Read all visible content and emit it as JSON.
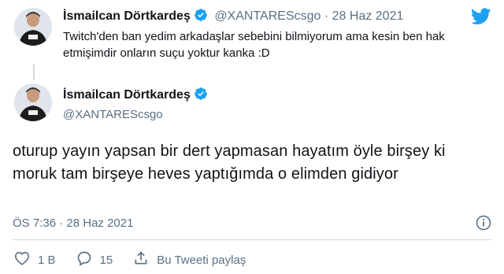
{
  "reply": {
    "author_name": "İsmailcan Dörtkardeş",
    "handle": "@XANTAREScsgo",
    "separator": "·",
    "date": "28 Haz 2021",
    "text": "Twitch'den ban yedim arkadaşlar sebebini bilmiyorum ama kesin ben hak etmişimdir onların suçu yoktur kanka :D"
  },
  "tweet": {
    "author_name": "İsmailcan Dörtkardeş",
    "handle": "@XANTAREScsgo",
    "text": "oturup yayın yapsan bir dert yapmasan hayatım öyle birşey ki moruk tam birşeye heves yaptığımda o elimden gidiyor",
    "time": "ÖS 7:36",
    "separator": "·",
    "date": "28 Haz 2021"
  },
  "actions": {
    "like_count": "1 B",
    "reply_count": "15",
    "share_label": "Bu Tweeti paylaş"
  },
  "colors": {
    "twitter_blue": "#1da1f2",
    "muted": "#5b7083",
    "text": "#0f1419"
  },
  "icons": [
    "twitter-bird-icon",
    "verified-badge-icon",
    "heart-icon",
    "reply-bubble-icon",
    "share-icon",
    "info-icon"
  ]
}
